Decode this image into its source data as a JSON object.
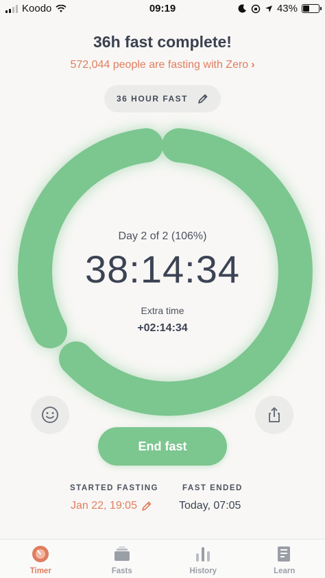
{
  "status_bar": {
    "carrier": "Koodo",
    "time": "09:19",
    "battery": "43%"
  },
  "header": {
    "title": "36h fast complete!",
    "subtitle": "572,044 people are fasting with Zero"
  },
  "fast_type": {
    "label": "36 HOUR FAST"
  },
  "progress": {
    "day_text": "Day 2 of 2 (106%)",
    "percent": 106,
    "elapsed": "38:14:34",
    "extra_label": "Extra time",
    "extra_value": "+02:14:34"
  },
  "actions": {
    "end_fast": "End fast"
  },
  "details": {
    "started_label": "STARTED FASTING",
    "started_value": "Jan 22, 19:05",
    "ended_label": "FAST ENDED",
    "ended_value": "Today, 07:05"
  },
  "tabs": [
    {
      "label": "Timer",
      "icon": "timer-icon",
      "active": true
    },
    {
      "label": "Fasts",
      "icon": "fasts-icon",
      "active": false
    },
    {
      "label": "History",
      "icon": "history-icon",
      "active": false
    },
    {
      "label": "Learn",
      "icon": "learn-icon",
      "active": false
    }
  ],
  "colors": {
    "accent": "#e07d5e",
    "ring": "#7cc68f",
    "text": "#3c4354",
    "background": "#f8f7f5"
  }
}
